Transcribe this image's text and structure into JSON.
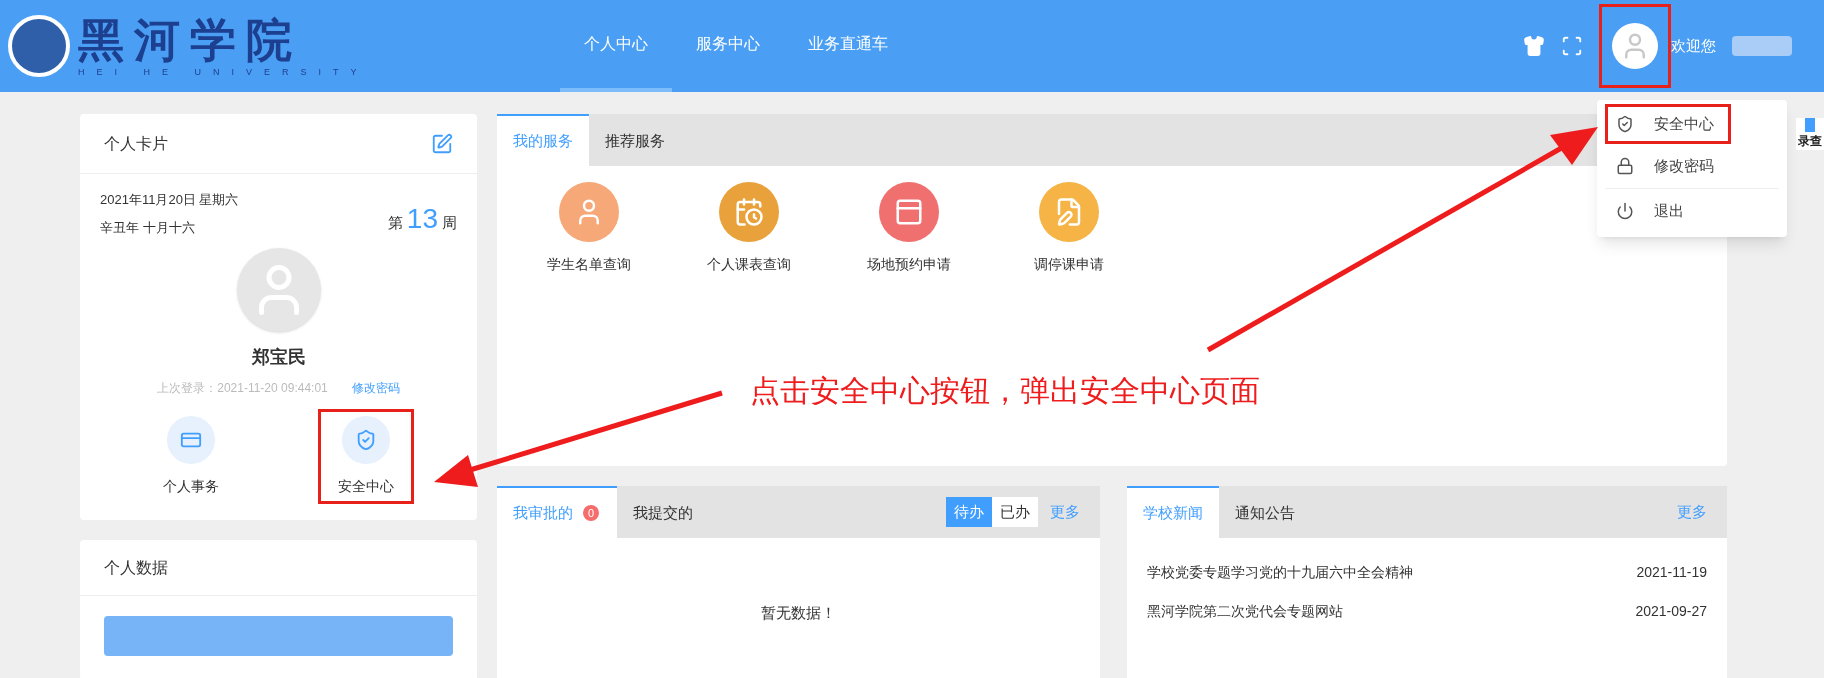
{
  "header": {
    "logo": {
      "title": "黑河学院",
      "subtitle": "HEI HE UNIVERSITY"
    },
    "nav": [
      {
        "label": "个人中心",
        "selected": true
      },
      {
        "label": "服务中心",
        "selected": false
      },
      {
        "label": "业务直通车",
        "selected": false
      }
    ],
    "avatar": {
      "highlighted": true
    },
    "welcome": "欢迎您"
  },
  "user_menu": {
    "items": [
      {
        "label": "安全中心",
        "highlighted": true
      },
      {
        "label": "修改密码",
        "highlighted": false
      },
      {
        "label": "退出",
        "highlighted": false
      }
    ]
  },
  "side_widget": {
    "label": "录查"
  },
  "profile_card": {
    "title": "个人卡片",
    "date": "2021年11月20日 星期六",
    "lunar_date": "辛丑年 十月十六",
    "week_prefix": "第",
    "week_number": "13",
    "week_suffix": "周",
    "name": "郑宝民",
    "last_login": "上次登录：2021-11-20 09:44:01",
    "change_password": "修改密码",
    "quick_links": [
      {
        "label": "个人事务",
        "highlighted": false
      },
      {
        "label": "安全中心",
        "highlighted": true
      }
    ]
  },
  "personal_data": {
    "title": "个人数据"
  },
  "services": {
    "tabs": [
      {
        "label": "我的服务",
        "selected": true
      },
      {
        "label": "推荐服务",
        "selected": false
      }
    ],
    "items": [
      {
        "label": "学生名单查询",
        "color": "#f6a878"
      },
      {
        "label": "个人课表查询",
        "color": "#e9a23b"
      },
      {
        "label": "场地预约申请",
        "color": "#f07070"
      },
      {
        "label": "调停课申请",
        "color": "#f5b445"
      }
    ]
  },
  "annotation": {
    "text": "点击安全中心按钮，弹出安全中心页面"
  },
  "approvals": {
    "tabs": [
      {
        "label": "我审批的",
        "badge": "0",
        "selected": true
      },
      {
        "label": "我提交的",
        "selected": false
      }
    ],
    "filters": [
      {
        "label": "待办",
        "selected": true
      },
      {
        "label": "已办",
        "selected": false
      }
    ],
    "more": "更多",
    "empty": "暂无数据！"
  },
  "news": {
    "tabs": [
      {
        "label": "学校新闻",
        "selected": true
      },
      {
        "label": "通知公告",
        "selected": false
      }
    ],
    "more": "更多",
    "items": [
      {
        "title": "学校党委专题学习党的十九届六中全会精神",
        "date": "2021-11-19"
      },
      {
        "title": "黑河学院第二次党代会专题网站",
        "date": "2021-09-27"
      }
    ]
  }
}
